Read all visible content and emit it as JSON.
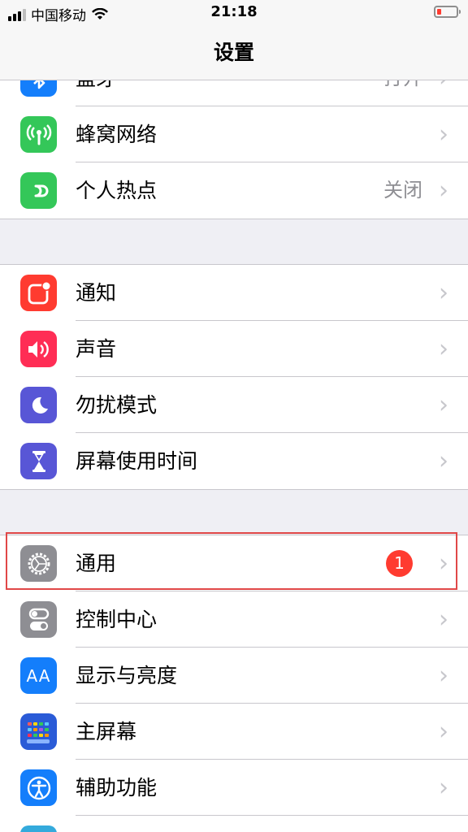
{
  "status": {
    "carrier": "中国移动",
    "time": "21:18"
  },
  "nav": {
    "title": "设置"
  },
  "rows_top": [
    {
      "label": "蓝牙",
      "value": "打开",
      "icon": "bluetooth-icon",
      "color": "#147efb"
    },
    {
      "label": "蜂窝网络",
      "value": "",
      "icon": "cellular-icon",
      "color": "#34c759"
    },
    {
      "label": "个人热点",
      "value": "关闭",
      "icon": "hotspot-icon",
      "color": "#34c759"
    }
  ],
  "rows_mid": [
    {
      "label": "通知",
      "icon": "notifications-icon",
      "color": "#ff3b30"
    },
    {
      "label": "声音",
      "icon": "sound-icon",
      "color": "#ff2d55"
    },
    {
      "label": "勿扰模式",
      "icon": "moon-icon",
      "color": "#5856d6"
    },
    {
      "label": "屏幕使用时间",
      "icon": "hourglass-icon",
      "color": "#5856d6"
    }
  ],
  "rows_bottom": [
    {
      "label": "通用",
      "badge": "1",
      "icon": "gear-icon",
      "color": "#8e8e93"
    },
    {
      "label": "控制中心",
      "icon": "toggles-icon",
      "color": "#8e8e93"
    },
    {
      "label": "显示与亮度",
      "icon": "aa-icon",
      "color": "#147efb"
    },
    {
      "label": "主屏幕",
      "icon": "home-grid-icon",
      "color": "#2a5bd7"
    },
    {
      "label": "辅助功能",
      "icon": "accessibility-icon",
      "color": "#147efb"
    }
  ],
  "aa_text": "AA"
}
